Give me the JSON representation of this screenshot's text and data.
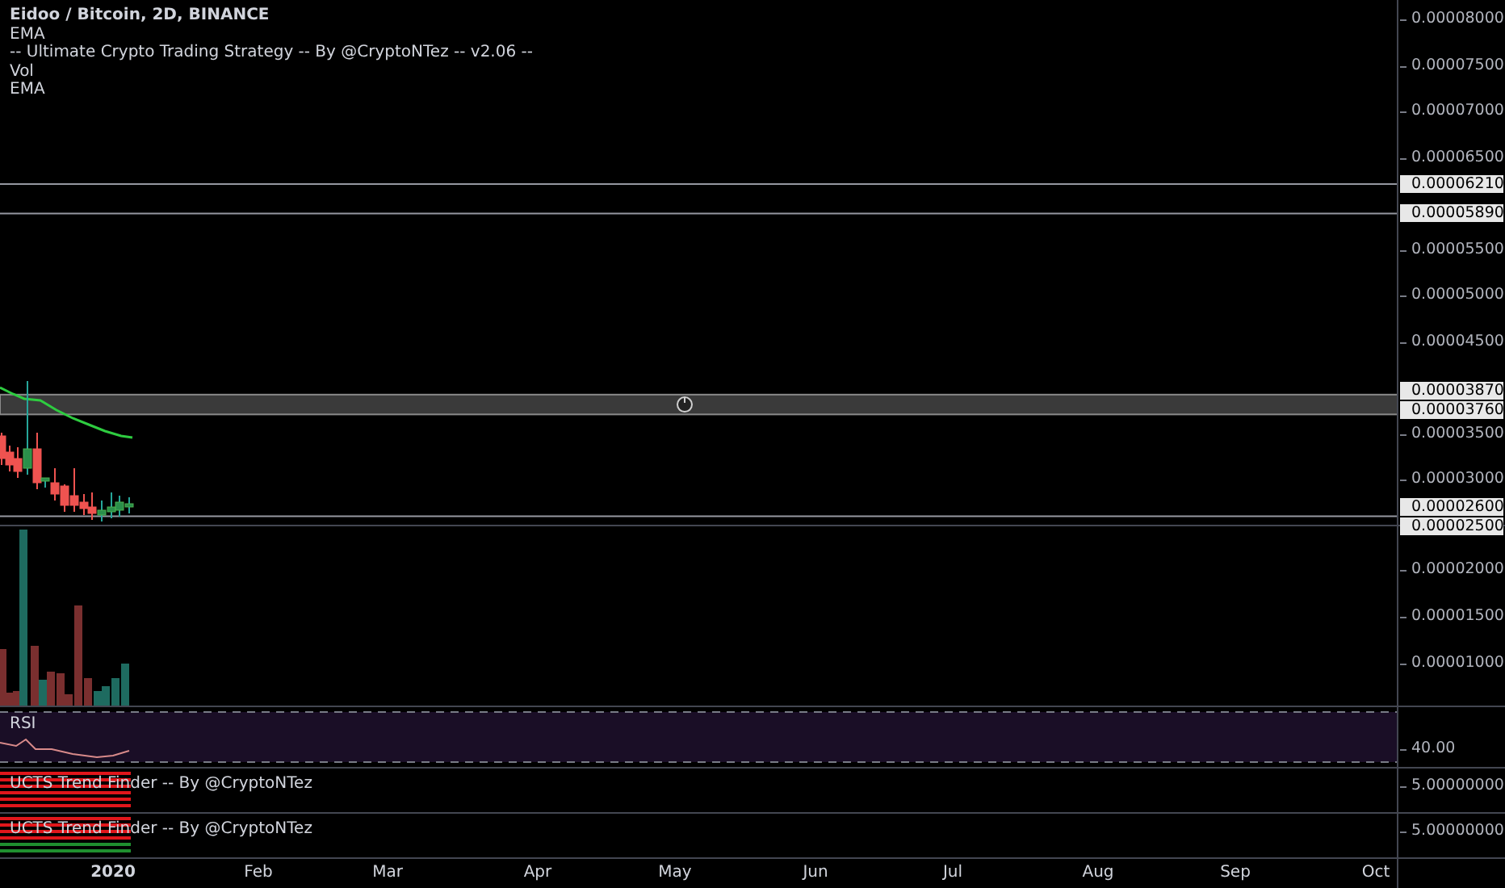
{
  "legend": {
    "title": "Eidoo / Bitcoin, 2D, BINANCE",
    "indicators": [
      "EMA",
      "-- Ultimate Crypto Trading Strategy -- By @CryptoNTez -- v2.06 --",
      "Vol",
      "EMA"
    ]
  },
  "price_axis": [
    {
      "label": "0.00008000",
      "kind": "tick"
    },
    {
      "label": "0.00007500",
      "kind": "tick"
    },
    {
      "label": "0.00007000",
      "kind": "tick"
    },
    {
      "label": "0.00006500",
      "kind": "tick"
    },
    {
      "label": "0.00006210",
      "kind": "line"
    },
    {
      "label": "0.00005890",
      "kind": "line"
    },
    {
      "label": "0.00005500",
      "kind": "tick"
    },
    {
      "label": "0.00005000",
      "kind": "tick"
    },
    {
      "label": "0.00004500",
      "kind": "tick"
    },
    {
      "label": "0.00003870",
      "kind": "band"
    },
    {
      "label": "0.00003760",
      "kind": "band"
    },
    {
      "label": "0.00003500",
      "kind": "tick"
    },
    {
      "label": "0.00003000",
      "kind": "tick"
    },
    {
      "label": "0.00002600",
      "kind": "line"
    },
    {
      "label": "0.00002500",
      "kind": "line"
    }
  ],
  "volume_axis": [
    "0.00002000",
    "0.00001500",
    "0.00001000"
  ],
  "rsi": {
    "title": "RSI",
    "axis": "40.00"
  },
  "trend_panes": [
    {
      "title": "UCTS Trend Finder -- By @CryptoNTez",
      "axis": "5.00000000"
    },
    {
      "title": "UCTS Trend Finder -- By @CryptoNTez",
      "axis": "5.00000000"
    }
  ],
  "time_axis": [
    {
      "label": "2020",
      "kind": "year"
    },
    {
      "label": "Feb",
      "kind": "month"
    },
    {
      "label": "Mar",
      "kind": "month"
    },
    {
      "label": "Apr",
      "kind": "month"
    },
    {
      "label": "May",
      "kind": "month"
    },
    {
      "label": "Jun",
      "kind": "month"
    },
    {
      "label": "Jul",
      "kind": "month"
    },
    {
      "label": "Aug",
      "kind": "month"
    },
    {
      "label": "Sep",
      "kind": "month"
    },
    {
      "label": "Oct",
      "kind": "month"
    }
  ]
}
